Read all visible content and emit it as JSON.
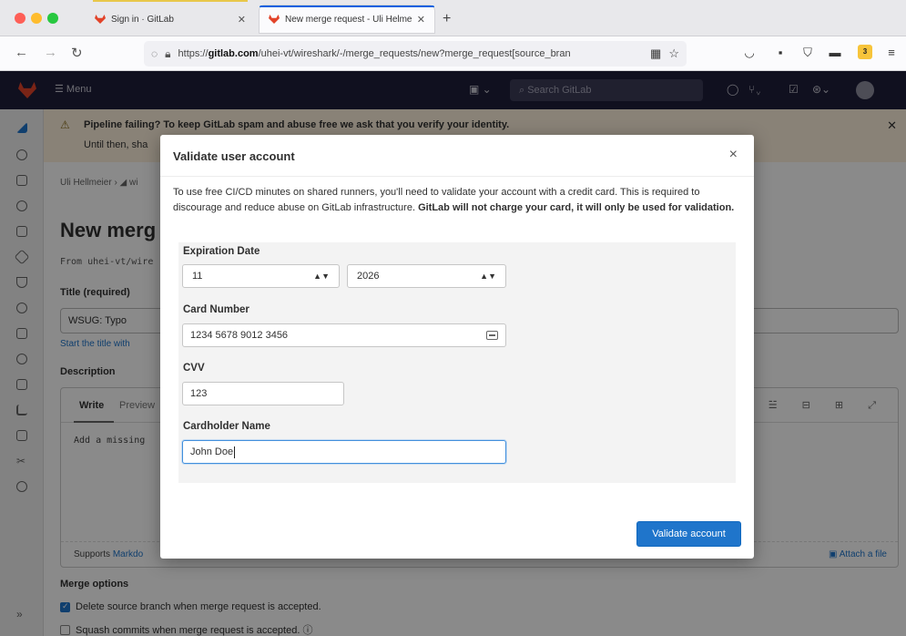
{
  "browser": {
    "tabs": [
      {
        "title": "Sign in · GitLab",
        "active": false
      },
      {
        "title": "New merge request - Uli Helmeı",
        "active": true
      }
    ],
    "url_prefix": "https://",
    "url_domain": "gitlab.com",
    "url_path": "/uhei-vt/wireshark/-/merge_requests/new?merge_request[source_bran",
    "extension_badge": "3"
  },
  "gitlab": {
    "menu_label": "Menu",
    "search_placeholder": "Search GitLab",
    "alert_title": "Pipeline failing? To keep GitLab spam and abuse free we ask that you verify your identity.",
    "alert_body": "Until then, sha",
    "breadcrumb": "Uli Hellmeier › ◢ wi",
    "page_title": "New merg",
    "from_line": "From uhei-vt/wire",
    "title_label": "Title (required)",
    "title_value": "WSUG: Typo",
    "start_title_hint": "Start the title with",
    "description_label": "Description",
    "write_tab": "Write",
    "preview_tab": "Preview",
    "editor_text": "Add a missing",
    "supports_prefix": "Supports ",
    "supports_link": "Markdo",
    "attach_file": "Attach a file",
    "merge_options_label": "Merge options",
    "option_delete_branch": "Delete source branch when merge request is accepted.",
    "option_squash": "Squash commits when merge request is accepted. ⓘ"
  },
  "modal": {
    "title": "Validate user account",
    "close_label": "×",
    "description_plain": "To use free CI/CD minutes on shared runners, you'll need to validate your account with a credit card. This is required to discourage and reduce abuse on GitLab infrastructure. ",
    "description_bold": "GitLab will not charge your card, it will only be used for validation.",
    "expiration_label": "Expiration Date",
    "expiration_month": "11",
    "expiration_year": "2026",
    "card_number_label": "Card Number",
    "card_number_value": "1234 5678 9012 3456",
    "cvv_label": "CVV",
    "cvv_value": "123",
    "cardholder_label": "Cardholder Name",
    "cardholder_value": "John Doe",
    "submit_label": "Validate account"
  },
  "colors": {
    "primary_button": "#1f75cb",
    "gitlab_topbar": "#1f1e3a",
    "alert_background": "#fdf1dd"
  }
}
